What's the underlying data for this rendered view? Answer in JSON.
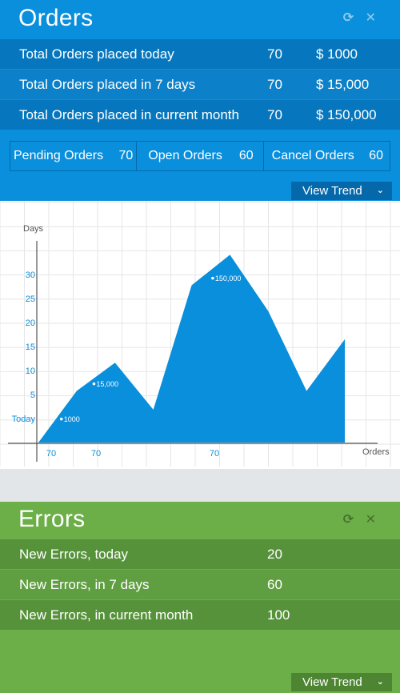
{
  "orders": {
    "title": "Orders",
    "refresh_icon": "⟳",
    "close_icon": "✕",
    "rows": [
      {
        "label": "Total Orders placed today",
        "count": "70",
        "amount": "$ 1000"
      },
      {
        "label": "Total Orders placed in 7 days",
        "count": "70",
        "amount": "$ 15,000"
      },
      {
        "label": "Total Orders placed in current month",
        "count": "70",
        "amount": "$ 150,000"
      }
    ],
    "stats": [
      {
        "label": "Pending Orders",
        "value": "70"
      },
      {
        "label": "Open Orders",
        "value": "60"
      },
      {
        "label": "Cancel Orders",
        "value": "60"
      }
    ],
    "trend_label": "View Trend",
    "accent": "#0a8fdc"
  },
  "chart_data": {
    "type": "area",
    "xlabel": "Orders",
    "ylabel": "Days",
    "y_ticks": [
      "Today",
      "5",
      "10",
      "15",
      "20",
      "25",
      "30"
    ],
    "x_tick_labels": [
      "70",
      "70",
      "70"
    ],
    "points": [
      {
        "x": 0,
        "y": -5
      },
      {
        "x": 2,
        "y": 6
      },
      {
        "x": 4,
        "y": 12
      },
      {
        "x": 6,
        "y": 2
      },
      {
        "x": 8,
        "y": 28.5
      },
      {
        "x": 10,
        "y": 35
      },
      {
        "x": 12,
        "y": 23
      },
      {
        "x": 14,
        "y": 6
      },
      {
        "x": 16,
        "y": 17
      }
    ],
    "annotations": [
      {
        "label": "1000",
        "x": 1.2,
        "y": 0
      },
      {
        "label": "15,000",
        "x": 2.9,
        "y": 7.5
      },
      {
        "label": "150,000",
        "x": 9.1,
        "y": 30
      }
    ],
    "xlim": [
      0,
      17
    ],
    "ylim": [
      -5,
      40
    ],
    "fill_color": "#0a8fdc",
    "grid": true
  },
  "errors": {
    "title": "Errors",
    "refresh_icon": "⟳",
    "close_icon": "✕",
    "rows": [
      {
        "label": "New Errors, today",
        "count": "20"
      },
      {
        "label": "New Errors, in 7 days",
        "count": "60"
      },
      {
        "label": "New Errors, in current month",
        "count": "100"
      }
    ],
    "trend_label": "View Trend",
    "accent": "#6cae47"
  }
}
